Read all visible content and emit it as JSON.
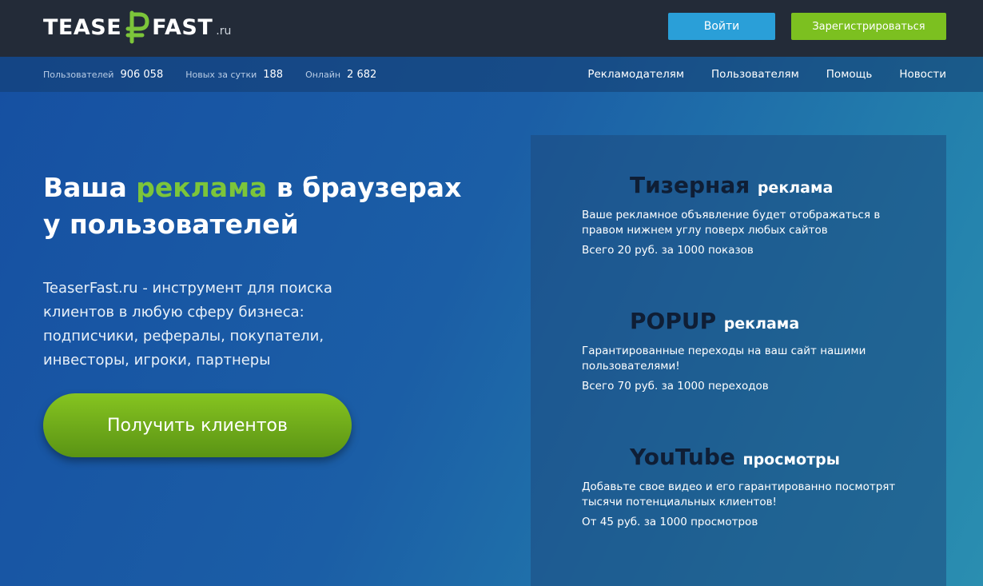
{
  "header": {
    "logo": {
      "left": "TEASE",
      "right": "FAST",
      "tld": ".ru"
    },
    "login_label": "Войти",
    "register_label": "Зарегистрироваться"
  },
  "stats": [
    {
      "label": "Пользователей",
      "value": "906 058"
    },
    {
      "label": "Новых за сутки",
      "value": "188"
    },
    {
      "label": "Онлайн",
      "value": "2 682"
    }
  ],
  "nav": [
    {
      "label": "Рекламодателям"
    },
    {
      "label": "Пользователям"
    },
    {
      "label": "Помощь"
    },
    {
      "label": "Новости"
    }
  ],
  "hero": {
    "headline_part1": "Ваша ",
    "headline_accent": "реклама",
    "headline_part2": " в браузерах",
    "headline_line2": "у пользователей",
    "description": "TeaserFast.ru - инструмент для поиска клиентов в любую сферу бизнеса: подписчики, рефералы, покупатели, инвесторы, игроки, партнеры",
    "cta_label": "Получить клиентов"
  },
  "features": [
    {
      "title_big": "Тизерная",
      "title_small": "реклама",
      "text": "Ваше рекламное объявление будет отображаться в правом нижнем углу поверх любых сайтов",
      "price": "Всего 20 руб. за 1000 показов"
    },
    {
      "title_big": "POPUP",
      "title_small": "реклама",
      "text": "Гарантированные переходы на ваш сайт нашими пользователями!",
      "price": "Всего 70 руб. за 1000 переходов"
    },
    {
      "title_big": "YouTube",
      "title_small": "просмотры",
      "text": "Добавьте свое видео и его гарантированно посмотрят тысячи потенциальных клиентов!",
      "price": "От 45 руб. за 1000 просмотров"
    }
  ],
  "colors": {
    "brand_green": "#7cc53a",
    "login_blue": "#2a9fd8",
    "header_dark": "#232b38"
  }
}
